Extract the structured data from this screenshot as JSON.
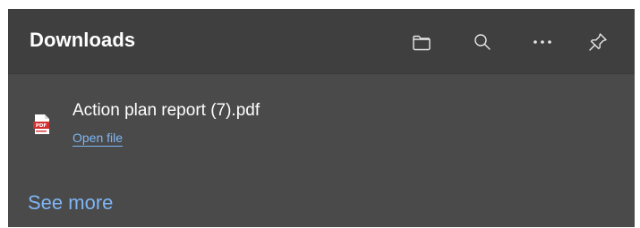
{
  "panel": {
    "title": "Downloads",
    "header_buttons": [
      {
        "icon": "folder-icon"
      },
      {
        "icon": "search-icon"
      },
      {
        "icon": "more-icon"
      },
      {
        "icon": "pin-icon"
      }
    ]
  },
  "downloads": [
    {
      "icon": "pdf-file-icon",
      "file_name": "Action plan report (7).pdf",
      "action_label": "Open file"
    }
  ],
  "footer": {
    "see_more_label": "See more"
  },
  "colors": {
    "panel_background": "#4a4a4a",
    "header_background": "#3f3f3f",
    "link": "#7fb6f5",
    "text": "#ffffff",
    "pdf_red": "#d32f2f"
  }
}
